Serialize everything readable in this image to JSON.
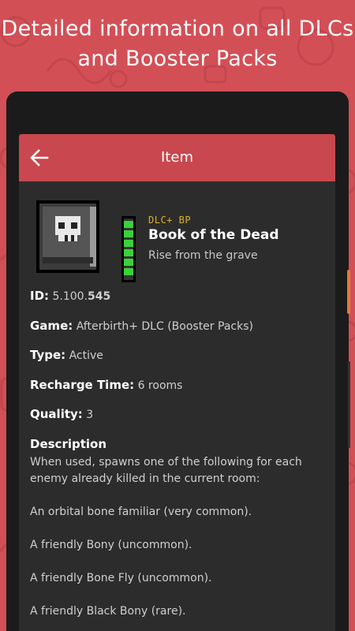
{
  "banner": {
    "headline": "Detailed information on all DLCs and Booster Packs"
  },
  "appbar": {
    "title": "Item",
    "back_icon": "arrow-left-icon"
  },
  "item": {
    "dlc_tag": "DLC+ BP",
    "name": "Book of the Dead",
    "tagline": "Rise from the grave",
    "charge_segments": 6,
    "icon": "book-of-the-dead-icon"
  },
  "details": {
    "id_label": "ID:",
    "id_value": "5.100.",
    "id_value_bold": "545",
    "game_label": "Game:",
    "game_value": "Afterbirth+ DLC (Booster Packs)",
    "type_label": "Type:",
    "type_value": "Active",
    "recharge_label": "Recharge Time:",
    "recharge_value": "6 rooms",
    "quality_label": "Quality:",
    "quality_value": "3"
  },
  "description": {
    "title": "Description",
    "paragraphs": [
      "When used, spawns one of the following for each enemy already killed in the current room:",
      "An orbital bone familiar (very common).",
      "A friendly Bony (uncommon).",
      "A friendly Bone Fly (uncommon).",
      "A friendly Black Bony (rare)."
    ]
  },
  "colors": {
    "background": "#d34f56",
    "appbar": "#c9474e",
    "card": "#2c2c2c",
    "dlc_tag": "#d8b12a",
    "charge_bar": "#3ad13a"
  }
}
